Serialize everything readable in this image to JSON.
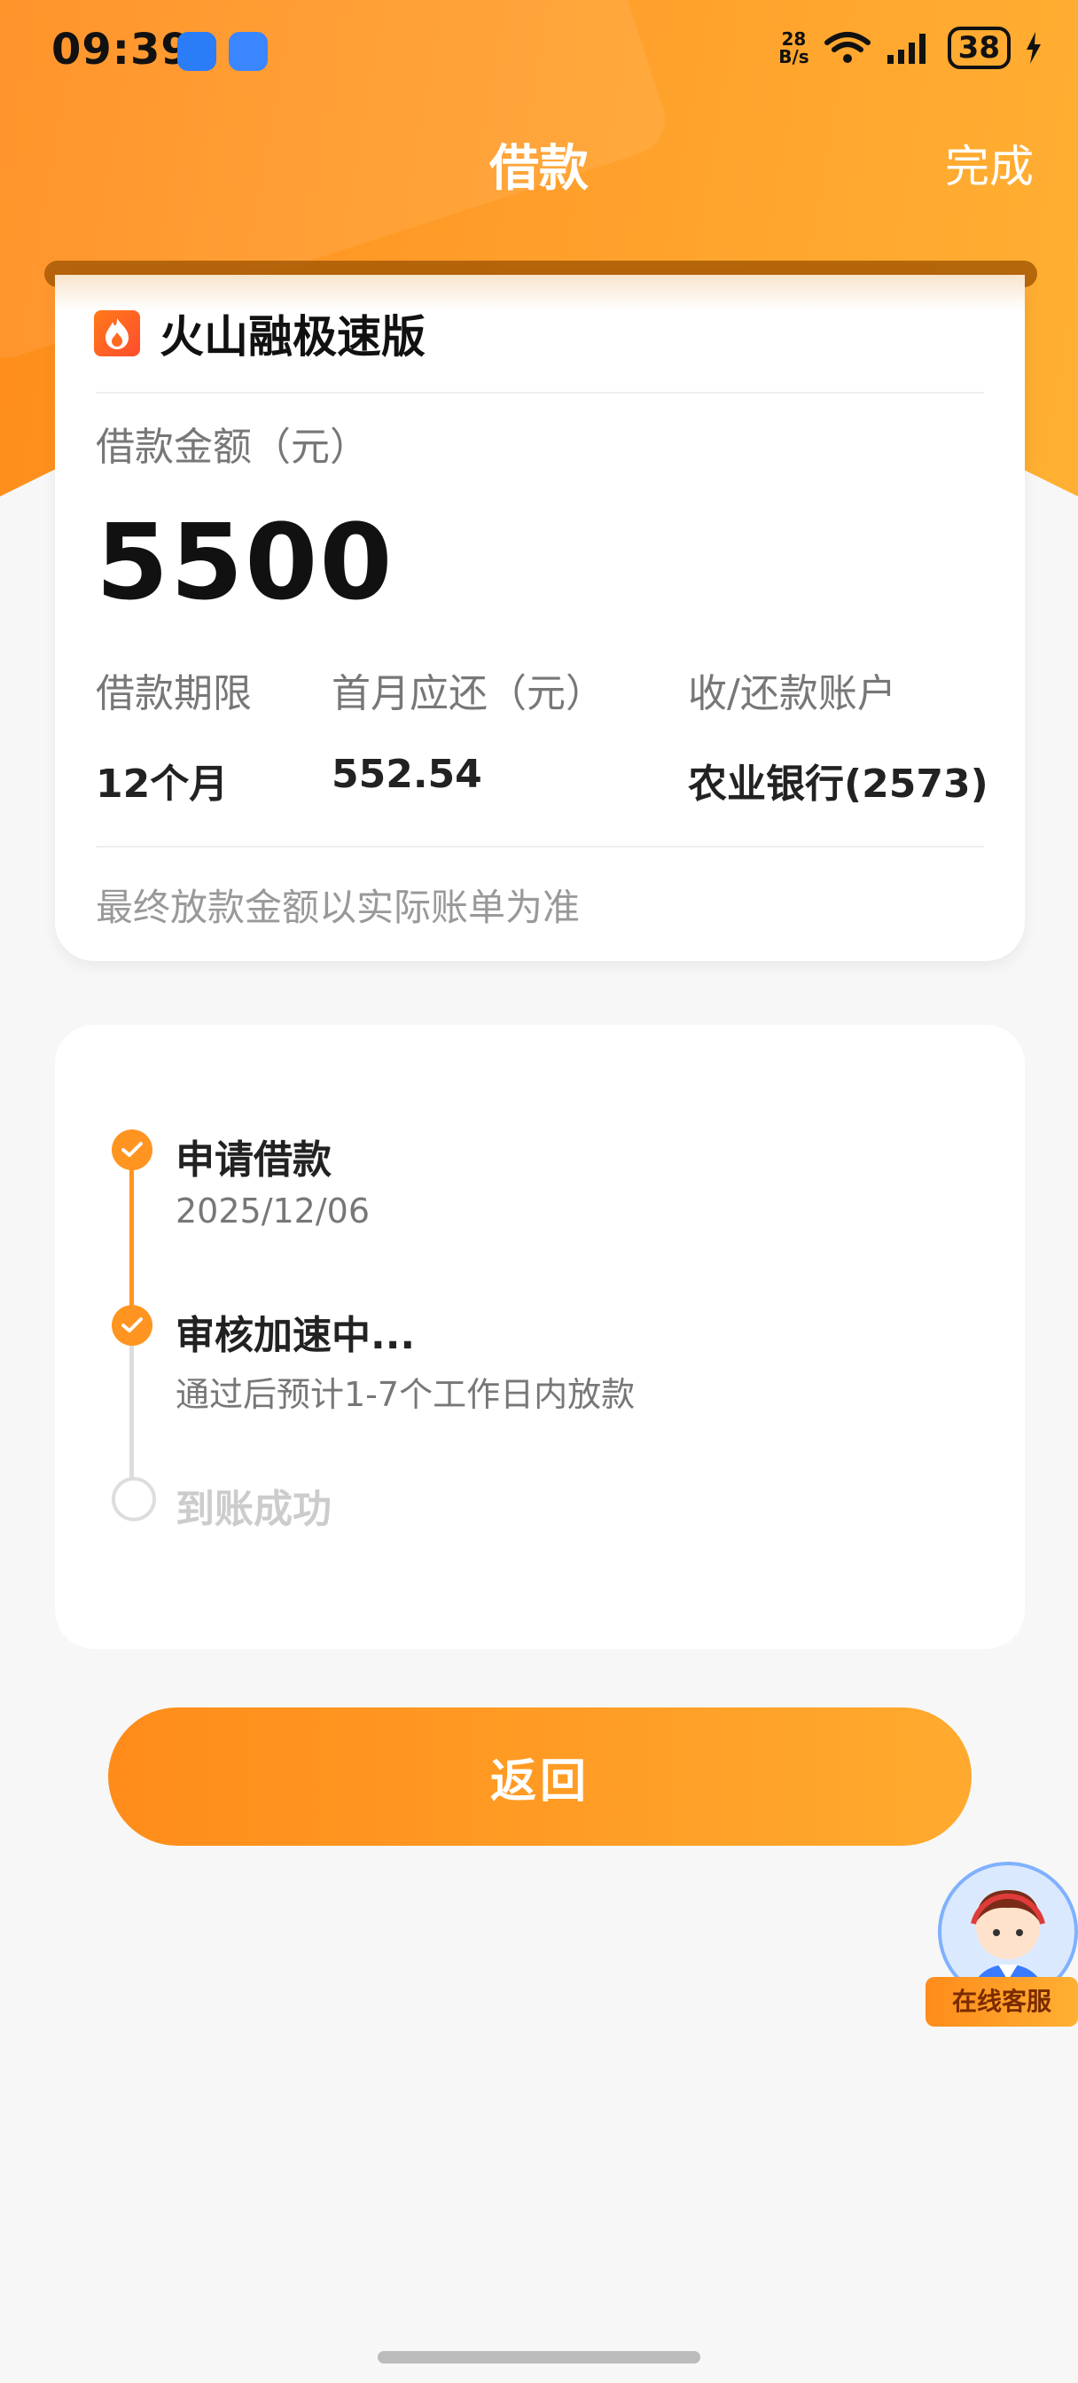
{
  "status_bar": {
    "time": "09:39",
    "net_speed_value": "28",
    "net_speed_unit": "B/s",
    "battery": "38"
  },
  "nav": {
    "title": "借款",
    "done_label": "完成"
  },
  "loan": {
    "brand": "火山融极速版",
    "amount_label": "借款金额（元）",
    "amount": "5500",
    "term_label": "借款期限",
    "term_value": "12个月",
    "first_payment_label": "首月应还（元）",
    "first_payment_value": "552.54",
    "account_label": "收/还款账户",
    "account_value": "农业银行(2573)",
    "note": "最终放款金额以实际账单为准"
  },
  "steps": [
    {
      "title": "申请借款",
      "sub": "2025/12/06",
      "status": "done"
    },
    {
      "title": "审核加速中...",
      "sub": "通过后预计1-7个工作日内放款",
      "status": "done"
    },
    {
      "title": "到账成功",
      "sub": "",
      "status": "pending"
    }
  ],
  "back_button": "返回",
  "service": {
    "label": "在线客服"
  },
  "colors": {
    "accent": "#ff9421",
    "pending": "#dddddd"
  }
}
